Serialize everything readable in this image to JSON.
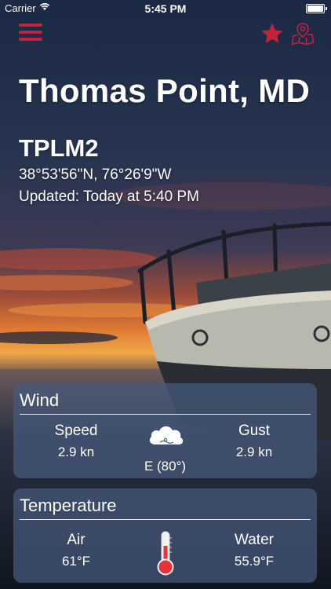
{
  "status_bar": {
    "carrier": "Carrier",
    "time": "5:45 PM",
    "wifi_icon": "wifi-icon",
    "battery_icon": "battery-icon"
  },
  "nav": {
    "menu_icon": "hamburger-menu-icon",
    "favorite_icon": "star-icon",
    "map_icon": "map-pin-icon",
    "accent_color": "#c4213a"
  },
  "station": {
    "location": "Thomas Point, MD",
    "id": "TPLM2",
    "coordinates": "38°53'56\"N, 76°26'9\"W",
    "updated": "Updated: Today at 5:40 PM"
  },
  "wind": {
    "title": "Wind",
    "speed_label": "Speed",
    "speed_value": "2.9 kn",
    "gust_label": "Gust",
    "gust_value": "2.9 kn",
    "direction": "E (80°)",
    "icon": "cloud-wind-icon"
  },
  "temperature": {
    "title": "Temperature",
    "air_label": "Air",
    "air_value": "61°F",
    "water_label": "Water",
    "water_value": "55.9°F",
    "icon": "thermometer-icon",
    "thermometer_color": "#e8323a"
  }
}
